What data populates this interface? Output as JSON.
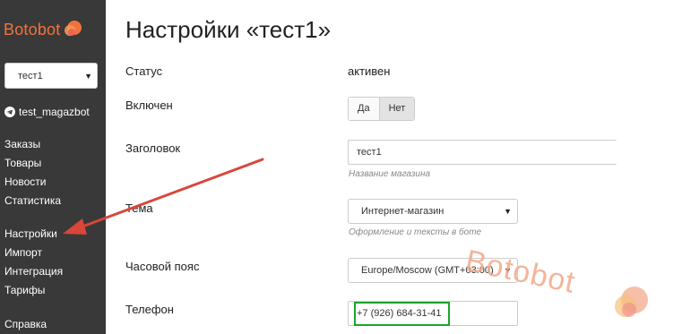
{
  "brand": {
    "name": "Botobot",
    "accent": "#f0733d"
  },
  "sidebar": {
    "bot_select": {
      "value": "тест1"
    },
    "bot_name": "test_magazbot",
    "nav_group1": [
      {
        "label": "Заказы"
      },
      {
        "label": "Товары"
      },
      {
        "label": "Новости"
      },
      {
        "label": "Статистика"
      }
    ],
    "nav_group2": [
      {
        "label": "Настройки"
      },
      {
        "label": "Импорт"
      },
      {
        "label": "Интеграция"
      },
      {
        "label": "Тарифы"
      }
    ],
    "nav_group3": [
      {
        "label": "Справка"
      }
    ]
  },
  "main": {
    "title": "Настройки «тест1»",
    "status": {
      "label": "Статус",
      "value": "активен"
    },
    "enabled": {
      "label": "Включен",
      "options": [
        "Да",
        "Нет"
      ],
      "selected": "Нет"
    },
    "header_field": {
      "label": "Заголовок",
      "value": "тест1",
      "hint": "Название магазина"
    },
    "theme": {
      "label": "Тема",
      "value": "Интернет-магазин",
      "hint": "Оформление и тексты в боте"
    },
    "timezone": {
      "label": "Часовой пояс",
      "value": "Europe/Moscow (GMT+03:00)"
    },
    "phone": {
      "label": "Телефон",
      "value": "+7 (926) 684-31-41"
    }
  },
  "watermark": "Botobot"
}
